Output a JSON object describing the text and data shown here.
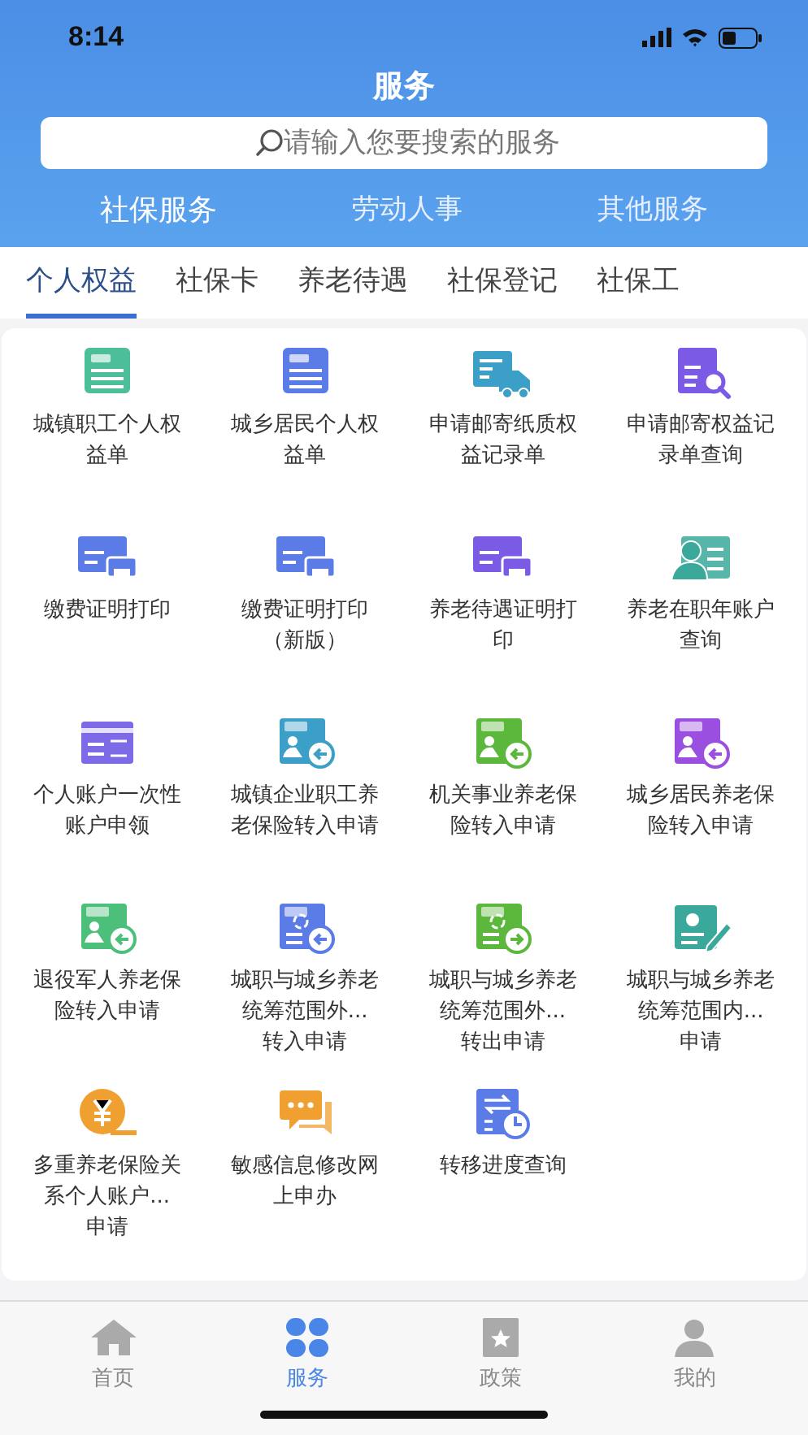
{
  "status_bar": {
    "time": "8:14"
  },
  "header": {
    "title": "服务"
  },
  "search": {
    "placeholder": "请输入您要搜索的服务"
  },
  "top_tabs": [
    {
      "label": "社保服务",
      "selected": true
    },
    {
      "label": "劳动人事",
      "selected": false
    },
    {
      "label": "其他服务",
      "selected": false
    }
  ],
  "sub_tabs": [
    {
      "label": "个人权益",
      "selected": true
    },
    {
      "label": "社保卡",
      "selected": false
    },
    {
      "label": "养老待遇",
      "selected": false
    },
    {
      "label": "社保登记",
      "selected": false
    },
    {
      "label": "社保工",
      "selected": false
    }
  ],
  "services": [
    {
      "label": "城镇职工个人权益单",
      "kind": "doc",
      "color": "#4cbf9a"
    },
    {
      "label": "城乡居民个人权益单",
      "kind": "doc",
      "color": "#5b7be6"
    },
    {
      "label": "申请邮寄纸质权益记录单",
      "kind": "truck",
      "color": "#3b9fc8"
    },
    {
      "label": "申请邮寄权益记录单查询",
      "kind": "search",
      "color": "#7b5be6"
    },
    {
      "label": "缴费证明打印",
      "kind": "printer",
      "color": "#5b7be6"
    },
    {
      "label": "缴费证明打印（新版）",
      "kind": "printer",
      "color": "#5b7be6"
    },
    {
      "label": "养老待遇证明打印",
      "kind": "printer",
      "color": "#7b5be6"
    },
    {
      "label": "养老在职年账户查询",
      "kind": "person",
      "color": "#3aa89a"
    },
    {
      "label": "个人账户一次性账户申领",
      "kind": "card",
      "color": "#7d6ae6"
    },
    {
      "label": "城镇企业职工养老保险转入申请",
      "kind": "in",
      "color": "#3b9fc8"
    },
    {
      "label": "机关事业养老保险转入申请",
      "kind": "in",
      "color": "#5cb83c"
    },
    {
      "label": "城乡居民养老保险转入申请",
      "kind": "in",
      "color": "#9b4fe0"
    },
    {
      "label": "退役军人养老保险转入申请",
      "kind": "in",
      "color": "#4cbf7a"
    },
    {
      "label": "城职与城乡养老统筹范围外...",
      "suffix": "转入申请",
      "kind": "cyclein",
      "color": "#5b7be6"
    },
    {
      "label": "城职与城乡养老统筹范围外...",
      "suffix": "转出申请",
      "kind": "cycleout",
      "color": "#5cb83c"
    },
    {
      "label": "城职与城乡养老统筹范围内...",
      "suffix": "申请",
      "kind": "edit",
      "color": "#3aa89a"
    },
    {
      "label": "多重养老保险关系个人账户...",
      "suffix": "申请",
      "kind": "yen",
      "color": "#f0a030"
    },
    {
      "label": "敏感信息修改网上申办",
      "kind": "chat",
      "color": "#f0a030"
    },
    {
      "label": "转移进度查询",
      "kind": "clock",
      "color": "#5b7be6"
    }
  ],
  "bottom_nav": [
    {
      "label": "首页",
      "kind": "home",
      "selected": false
    },
    {
      "label": "服务",
      "kind": "grid",
      "selected": true
    },
    {
      "label": "政策",
      "kind": "bookmark",
      "selected": false
    },
    {
      "label": "我的",
      "kind": "user",
      "selected": false
    }
  ]
}
